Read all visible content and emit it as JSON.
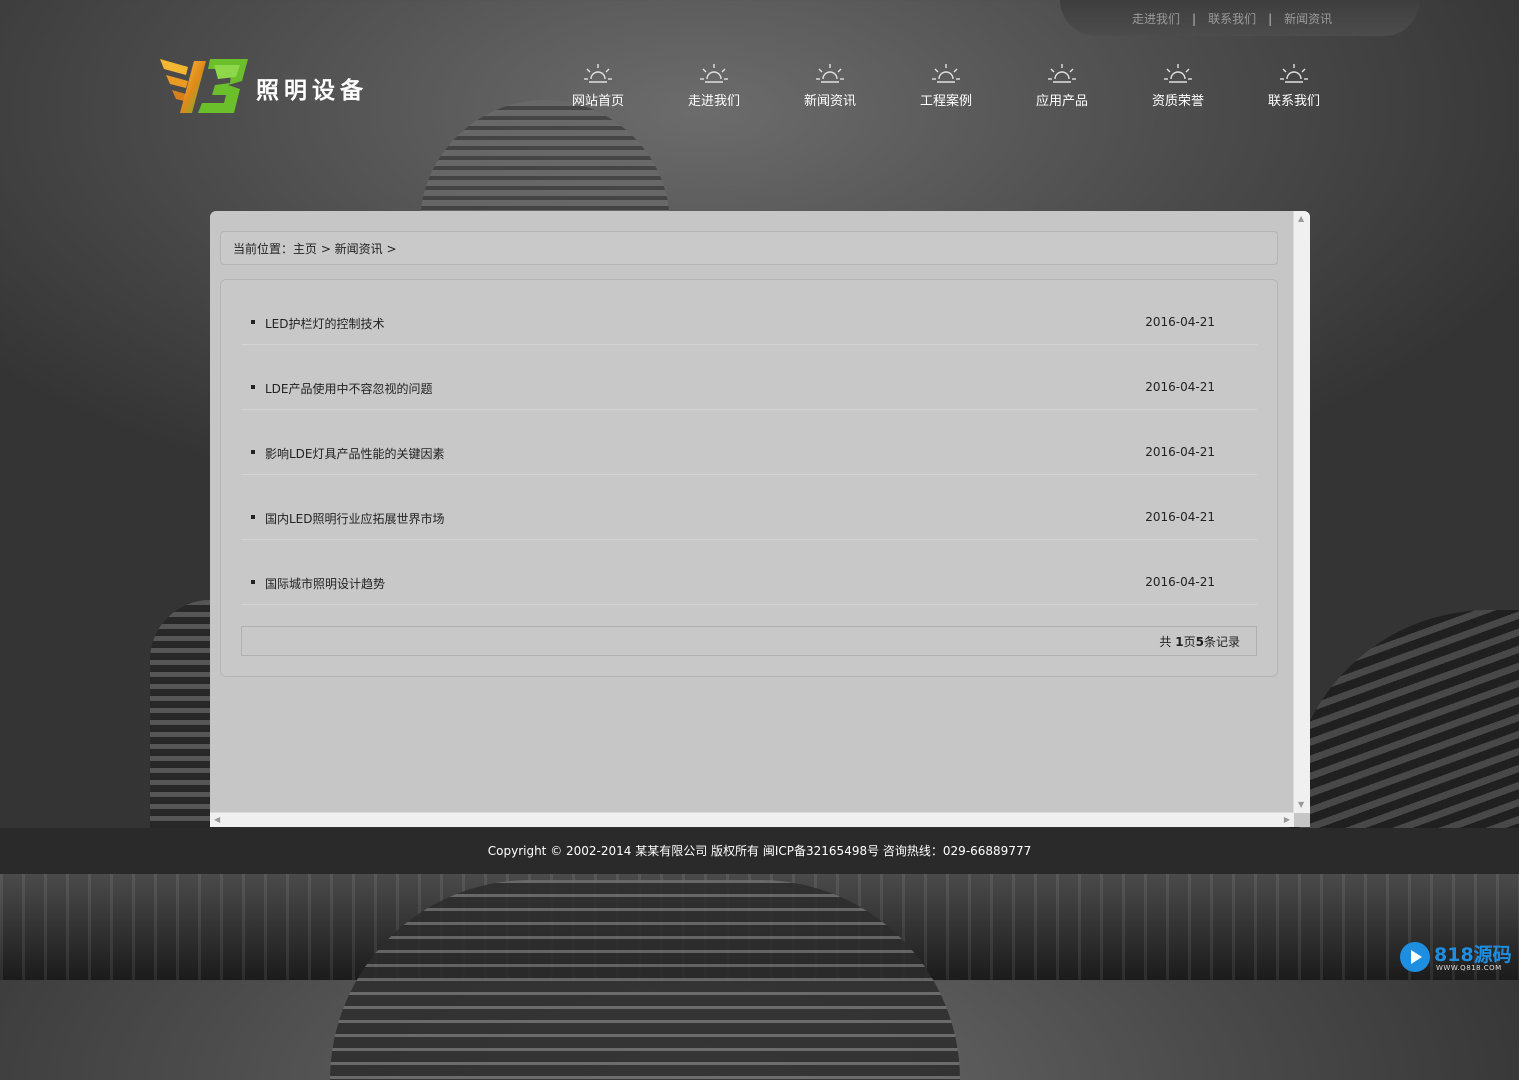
{
  "top_links": [
    "走进我们",
    "联系我们",
    "新闻资讯"
  ],
  "top_separator": "|",
  "logo": {
    "text": "照明设备"
  },
  "nav": [
    "网站首页",
    "走进我们",
    "新闻资讯",
    "工程案例",
    "应用产品",
    "资质荣誉",
    "联系我们"
  ],
  "breadcrumb": {
    "text": "当前位置：主页 > 新闻资讯 >"
  },
  "news": [
    {
      "title": "LED护栏灯的控制技术",
      "date": "2016-04-21"
    },
    {
      "title": "LDE产品使用中不容忽视的问题",
      "date": "2016-04-21"
    },
    {
      "title": "影响LDE灯具产品性能的关键因素",
      "date": "2016-04-21"
    },
    {
      "title": "国内LED照明行业应拓展世界市场",
      "date": "2016-04-21"
    },
    {
      "title": "国际城市照明设计趋势",
      "date": "2016-04-21"
    }
  ],
  "pager": {
    "prefix": "共 ",
    "pages": "1",
    "mid": "页",
    "records": "5",
    "suffix": "条记录"
  },
  "footer": {
    "text": "Copyright © 2002-2014 某某有限公司 版权所有 闽ICP备32165498号 咨询热线：029-66889777"
  },
  "watermark": {
    "digits": "818",
    "chars": "源码",
    "url": "WWW.Q818.COM"
  },
  "colors": {
    "panel_bg": "#c6c6c6",
    "footer_bg": "#2a2a2a",
    "logo_green": "#6bbf2a",
    "logo_orange": "#f0a020"
  }
}
